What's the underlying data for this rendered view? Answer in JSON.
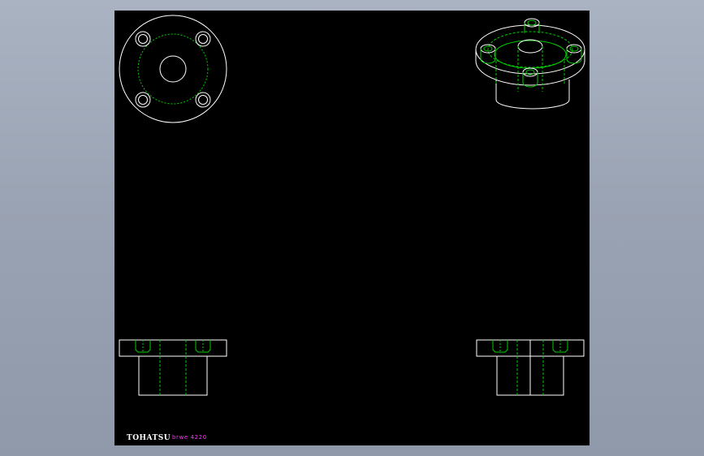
{
  "colors": {
    "background": "#000000",
    "outline": "#ffffff",
    "hidden": "#00cc00",
    "label_code": "#ff33ff"
  },
  "labels": {
    "brand": "TOHATSU",
    "code": "brwe 4220"
  },
  "views": [
    "top-view",
    "isometric-view",
    "front-section-view",
    "side-section-view"
  ]
}
